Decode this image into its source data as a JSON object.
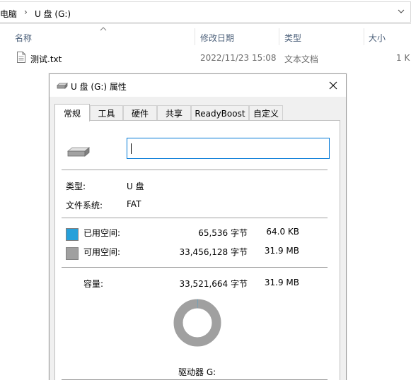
{
  "explorer": {
    "breadcrumb": [
      "电脑",
      "U 盘 (G:)"
    ],
    "columns": [
      "名称",
      "修改日期",
      "类型",
      "大小"
    ],
    "files": [
      {
        "name": "测试.txt",
        "modified": "2022/11/23 15:08",
        "type": "文本文档",
        "size": "1 K"
      }
    ]
  },
  "dialog": {
    "title": "U 盘 (G:) 属性",
    "tabs": [
      "常规",
      "工具",
      "硬件",
      "共享",
      "ReadyBoost",
      "自定义"
    ],
    "active_tab": "常规",
    "volume_label_value": "",
    "type_label": "类型:",
    "type_value": "U 盘",
    "fs_label": "文件系统:",
    "fs_value": "FAT",
    "used_label": "已用空间:",
    "used_bytes": "65,536 字节",
    "used_human": "64.0 KB",
    "free_label": "可用空间:",
    "free_bytes": "33,456,128 字节",
    "free_human": "31.9 MB",
    "capacity_label": "容量:",
    "capacity_bytes": "33,521,664 字节",
    "capacity_human": "31.9 MB",
    "drive_label": "驱动器 G:",
    "used_fraction": 0.00196,
    "colors": {
      "used": "#26a0da",
      "free": "#a0a0a0"
    }
  }
}
